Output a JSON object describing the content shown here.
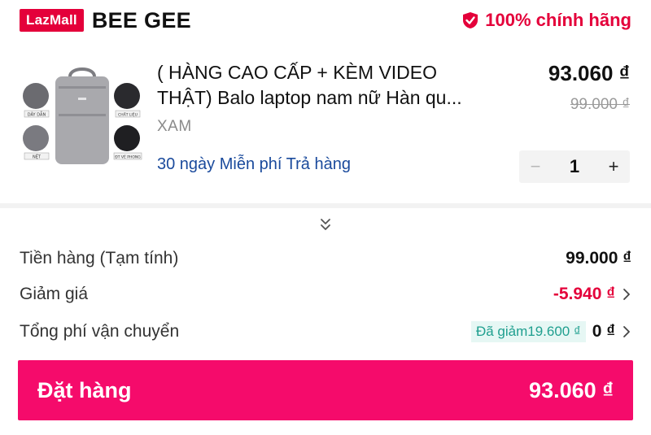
{
  "shop": {
    "badge": "LazMall",
    "name": "BEE GEE",
    "genuine_label": "100% chính hãng"
  },
  "product": {
    "title_line1": "( HÀNG CAO CẤP + KÈM VIDEO",
    "title_line2": "THẬT) Balo laptop nam nữ Hàn qu...",
    "variant": "XAM",
    "return_policy": "30 ngày Miễn phí Trả hàng",
    "price": "93.060 ₫",
    "original_price": "99.000 ₫",
    "quantity": "1",
    "image_labels": [
      "DÂY DẪN",
      "CHẤT LIỆU",
      "NỆT",
      "ĐT VẼ PHONG"
    ]
  },
  "summary": {
    "subtotal_label": "Tiền hàng (Tạm tính)",
    "subtotal_value": "99.000 ₫",
    "discount_label": "Giảm giá",
    "discount_value": "-5.940 ₫",
    "shipping_label": "Tổng phí vận chuyển",
    "shipping_saved": "Đã giảm19.600 ₫",
    "shipping_value": "0 ₫"
  },
  "checkout": {
    "button_label": "Đặt hàng",
    "total": "93.060 ₫"
  },
  "colors": {
    "brand": "#e4003a",
    "checkout_button": "#f50b6b",
    "link_blue": "#1a4a9c",
    "saved_green": "#1f9f8f"
  }
}
